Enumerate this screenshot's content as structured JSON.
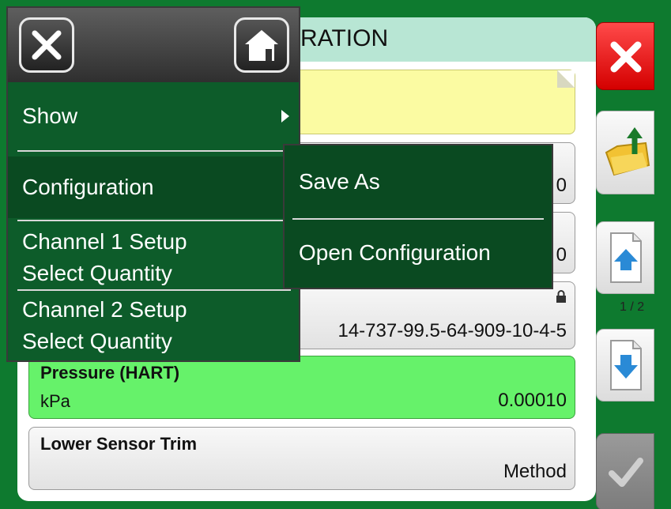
{
  "title_fragment": "RATION",
  "menu": {
    "show_label": "Show",
    "configuration_label": "Configuration",
    "channel1_line1": "Channel 1 Setup",
    "channel1_line2": "Select Quantity",
    "channel2_line1": "Channel 2 Setup",
    "channel2_line2": "Select Quantity"
  },
  "submenu": {
    "save_as": "Save As",
    "open_configuration": "Open Configuration"
  },
  "cards": {
    "card2_value_fragment": "0",
    "card3_value_fragment": "0",
    "card4_value": "14-737-99.5-64-909-10-4-5",
    "pressure": {
      "title": "Pressure (HART)",
      "unit": "kPa",
      "value": "0.00010"
    },
    "trim": {
      "title": "Lower Sensor Trim",
      "value": "Method"
    }
  },
  "pagination": "1 / 2",
  "colors": {
    "background": "#0e7a2f",
    "menu": "#0d5c2a",
    "highlight": "#66f26a",
    "note": "#fbfba2",
    "close": "#d40000"
  }
}
